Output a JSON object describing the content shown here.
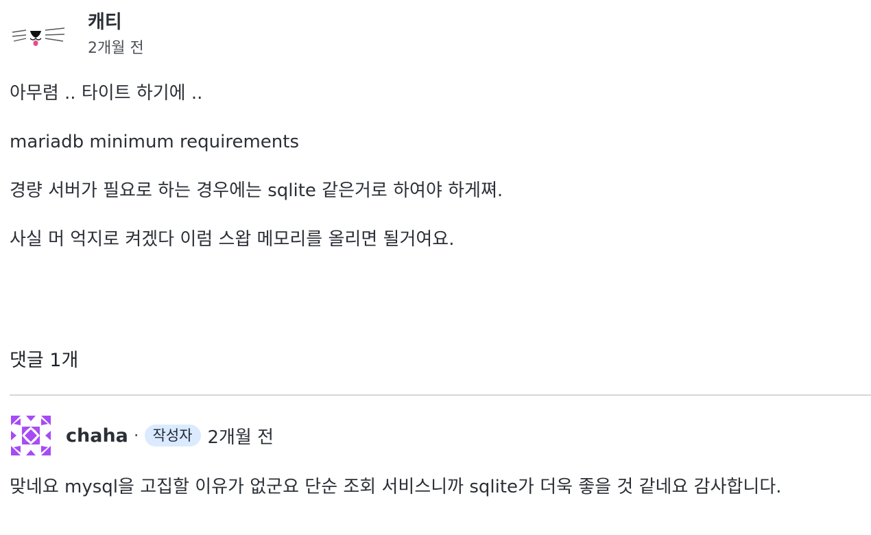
{
  "post": {
    "author_name": "캐티",
    "time": "2개월 전",
    "avatar_icon": "cat-face-icon",
    "paragraphs": [
      "아무렴 .. 타이트 하기에 ..",
      "mariadb minimum requirements",
      "경량 서버가 필요로 하는 경우에는 sqlite 같은거로 하여야 하게쪄.",
      "사실 머 억지로 켜겠다 이럼 스왑 메모리를 올리면 될거여요."
    ]
  },
  "comments_section": {
    "count_label": "댓글 1개"
  },
  "comments": [
    {
      "author_name": "chaha",
      "separator": "·",
      "badge": "작성자",
      "time": "2개월 전",
      "text": "맞네요 mysql을 고집할 이유가 없군요 단순 조회 서비스니까 sqlite가 더욱 좋을 것 같네요 감사합니다.",
      "avatar_icon": "identicon-avatar-icon"
    }
  ],
  "colors": {
    "badge_bg": "#dbeafe",
    "divider": "#d4d6da",
    "identicon": "#a64bf4",
    "cat_tongue": "#e84a8c"
  }
}
